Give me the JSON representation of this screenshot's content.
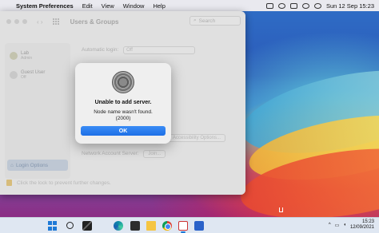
{
  "menubar": {
    "app_name": "System Preferences",
    "items": [
      "Edit",
      "View",
      "Window",
      "Help"
    ],
    "datetime": "Sun 12 Sep  15:23"
  },
  "window": {
    "title": "Users & Groups",
    "search_placeholder": "Search",
    "users": [
      {
        "name": "Lab",
        "role": "Admin"
      },
      {
        "name": "Guest User",
        "role": "Off"
      }
    ],
    "sidebar_selected": "Login Options",
    "rows": [
      {
        "label": "Automatic login:",
        "value": "Off"
      },
      {
        "label": "Network Account Server:",
        "button": "Join..."
      }
    ],
    "accessibility_button": "Accessibility Options...",
    "lock_text": "Click the lock to prevent further changes."
  },
  "dialog": {
    "title": "Unable to add server.",
    "message_line1": "Node name wasn't found.",
    "message_line2": "(2000)",
    "ok_label": "OK"
  },
  "taskbar": {
    "time": "15:23",
    "date": "12/09/2021",
    "tray_chevron": "^"
  },
  "colors": {
    "accent": "#1d6fe6",
    "menubar_bg": "#e9e9ef",
    "taskbar_bg": "#dfe7f2"
  }
}
